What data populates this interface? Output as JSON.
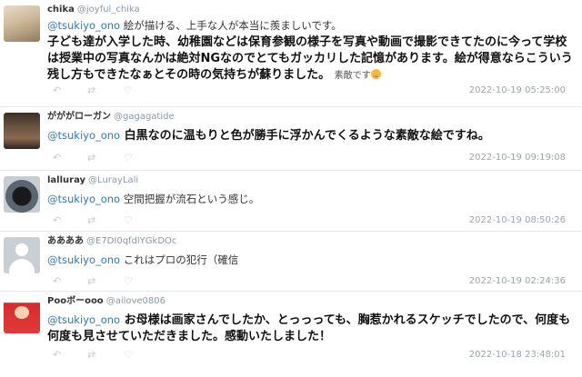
{
  "replies": [
    {
      "name": "chika",
      "handle": "@joyful_chika",
      "mention": "@tsukiyo_ono",
      "text_first": "絵が描ける、上手な人が本当に羨ましいです。",
      "text_bold": "子ども達が入学した時、幼稚園などは保育参観の様子を写真や動画で撮影できてたのに今って学校は授業中の写真なんかは絶対NGなのでとてもガッカリした記憶があります。絵が得意ならこういう残し方もできたなぁとその時の気持ちが蘇りました。",
      "text_tail": "素敵です",
      "timestamp": "2022-10-19 05:25:00"
    },
    {
      "name": "がががローガン",
      "handle": "@gagagatide",
      "mention": "@tsukiyo_ono",
      "text": "白黒なのに温もりと色が勝手に浮かんでくるような素敵な絵ですね。",
      "timestamp": "2022-10-19 09:19:08"
    },
    {
      "name": "lalluray",
      "handle": "@LurayLali",
      "mention": "@tsukiyo_ono",
      "text": "空間把握が流石という感じ。",
      "timestamp": "2022-10-19 08:50:26"
    },
    {
      "name": "ああああ",
      "handle": "@E7DI0qfdlYGkDOc",
      "mention": "@tsukiyo_ono",
      "text": "これはプロの犯行（確信",
      "timestamp": "2022-10-19 02:24:36"
    },
    {
      "name": "Pooボーooo",
      "handle": "@ailove0806",
      "mention": "@tsukiyo_ono",
      "text": "お母様は画家さんでしたか、とっっっても、胸惹かれるスケッチでしたので、何度も何度も見させていただきました。感動いたしました！",
      "timestamp": "2022-10-18 23:48:01"
    }
  ],
  "icons": {
    "reply": "reply-icon",
    "retweet": "retweet-icon",
    "like": "like-icon",
    "emoji": "smiling-face-emoji"
  }
}
